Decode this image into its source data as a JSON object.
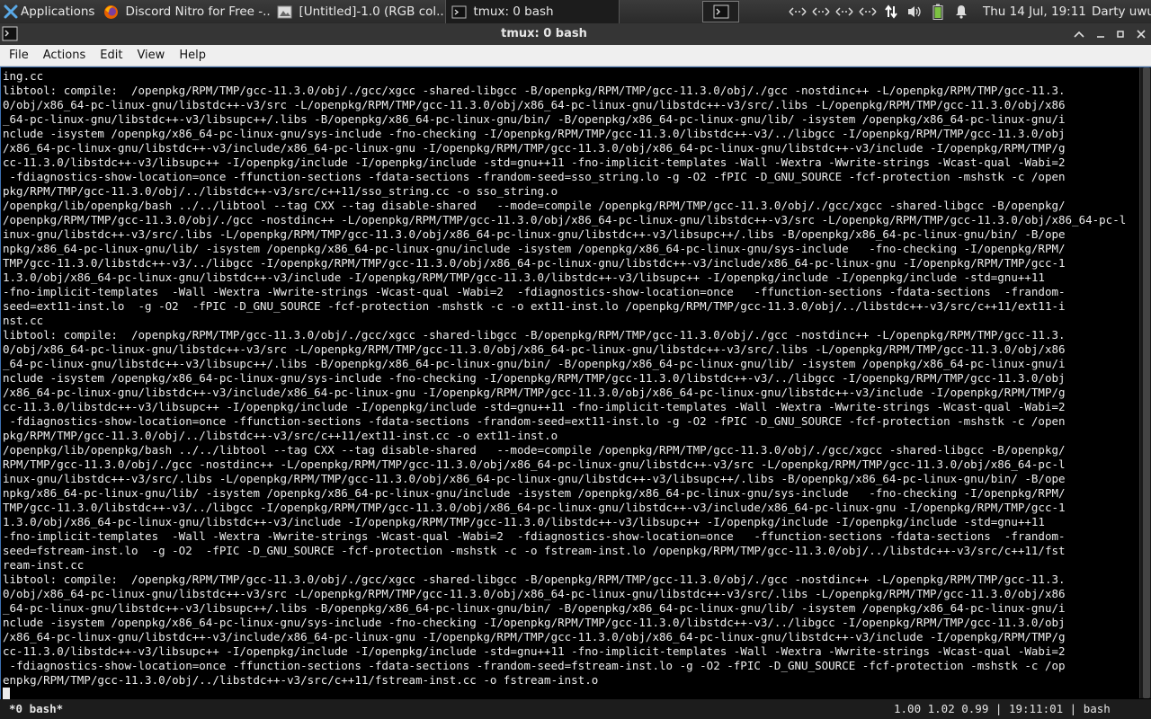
{
  "panel": {
    "app_menu_label": "Applications",
    "tasks": [
      {
        "label": "Discord Nitro for Free -..."
      },
      {
        "label": "[Untitled]-1.0 (RGB col..."
      },
      {
        "label": "tmux: 0 bash"
      }
    ],
    "clock": "Thu 14 Jul, 19:11",
    "user": "Darty uwu"
  },
  "window": {
    "title": "tmux: 0 bash"
  },
  "menubar": {
    "items": [
      "File",
      "Actions",
      "Edit",
      "View",
      "Help"
    ]
  },
  "terminal": {
    "lines": [
      "ing.cc",
      "libtool: compile:  /openpkg/RPM/TMP/gcc-11.3.0/obj/./gcc/xgcc -shared-libgcc -B/openpkg/RPM/TMP/gcc-11.3.0/obj/./gcc -nostdinc++ -L/openpkg/RPM/TMP/gcc-11.3.",
      "0/obj/x86_64-pc-linux-gnu/libstdc++-v3/src -L/openpkg/RPM/TMP/gcc-11.3.0/obj/x86_64-pc-linux-gnu/libstdc++-v3/src/.libs -L/openpkg/RPM/TMP/gcc-11.3.0/obj/x86",
      "_64-pc-linux-gnu/libstdc++-v3/libsupc++/.libs -B/openpkg/x86_64-pc-linux-gnu/bin/ -B/openpkg/x86_64-pc-linux-gnu/lib/ -isystem /openpkg/x86_64-pc-linux-gnu/i",
      "nclude -isystem /openpkg/x86_64-pc-linux-gnu/sys-include -fno-checking -I/openpkg/RPM/TMP/gcc-11.3.0/libstdc++-v3/../libgcc -I/openpkg/RPM/TMP/gcc-11.3.0/obj",
      "/x86_64-pc-linux-gnu/libstdc++-v3/include/x86_64-pc-linux-gnu -I/openpkg/RPM/TMP/gcc-11.3.0/obj/x86_64-pc-linux-gnu/libstdc++-v3/include -I/openpkg/RPM/TMP/g",
      "cc-11.3.0/libstdc++-v3/libsupc++ -I/openpkg/include -I/openpkg/include -std=gnu++11 -fno-implicit-templates -Wall -Wextra -Wwrite-strings -Wcast-qual -Wabi=2",
      " -fdiagnostics-show-location=once -ffunction-sections -fdata-sections -frandom-seed=sso_string.lo -g -O2 -fPIC -D_GNU_SOURCE -fcf-protection -mshstk -c /open",
      "pkg/RPM/TMP/gcc-11.3.0/obj/../libstdc++-v3/src/c++11/sso_string.cc -o sso_string.o",
      "/openpkg/lib/openpkg/bash ../../libtool --tag CXX --tag disable-shared   --mode=compile /openpkg/RPM/TMP/gcc-11.3.0/obj/./gcc/xgcc -shared-libgcc -B/openpkg/",
      "/openpkg/RPM/TMP/gcc-11.3.0/obj/./gcc -nostdinc++ -L/openpkg/RPM/TMP/gcc-11.3.0/obj/x86_64-pc-linux-gnu/libstdc++-v3/src -L/openpkg/RPM/TMP/gcc-11.3.0/obj/x86_64-pc-l",
      "inux-gnu/libstdc++-v3/src/.libs -L/openpkg/RPM/TMP/gcc-11.3.0/obj/x86_64-pc-linux-gnu/libstdc++-v3/libsupc++/.libs -B/openpkg/x86_64-pc-linux-gnu/bin/ -B/ope",
      "npkg/x86_64-pc-linux-gnu/lib/ -isystem /openpkg/x86_64-pc-linux-gnu/include -isystem /openpkg/x86_64-pc-linux-gnu/sys-include   -fno-checking -I/openpkg/RPM/",
      "TMP/gcc-11.3.0/libstdc++-v3/../libgcc -I/openpkg/RPM/TMP/gcc-11.3.0/obj/x86_64-pc-linux-gnu/libstdc++-v3/include/x86_64-pc-linux-gnu -I/openpkg/RPM/TMP/gcc-1",
      "1.3.0/obj/x86_64-pc-linux-gnu/libstdc++-v3/include -I/openpkg/RPM/TMP/gcc-11.3.0/libstdc++-v3/libsupc++ -I/openpkg/include -I/openpkg/include -std=gnu++11",
      "-fno-implicit-templates  -Wall -Wextra -Wwrite-strings -Wcast-qual -Wabi=2  -fdiagnostics-show-location=once   -ffunction-sections -fdata-sections  -frandom-",
      "seed=ext11-inst.lo  -g -O2  -fPIC -D_GNU_SOURCE -fcf-protection -mshstk -c -o ext11-inst.lo /openpkg/RPM/TMP/gcc-11.3.0/obj/../libstdc++-v3/src/c++11/ext11-i",
      "nst.cc",
      "libtool: compile:  /openpkg/RPM/TMP/gcc-11.3.0/obj/./gcc/xgcc -shared-libgcc -B/openpkg/RPM/TMP/gcc-11.3.0/obj/./gcc -nostdinc++ -L/openpkg/RPM/TMP/gcc-11.3.",
      "0/obj/x86_64-pc-linux-gnu/libstdc++-v3/src -L/openpkg/RPM/TMP/gcc-11.3.0/obj/x86_64-pc-linux-gnu/libstdc++-v3/src/.libs -L/openpkg/RPM/TMP/gcc-11.3.0/obj/x86",
      "_64-pc-linux-gnu/libstdc++-v3/libsupc++/.libs -B/openpkg/x86_64-pc-linux-gnu/bin/ -B/openpkg/x86_64-pc-linux-gnu/lib/ -isystem /openpkg/x86_64-pc-linux-gnu/i",
      "nclude -isystem /openpkg/x86_64-pc-linux-gnu/sys-include -fno-checking -I/openpkg/RPM/TMP/gcc-11.3.0/libstdc++-v3/../libgcc -I/openpkg/RPM/TMP/gcc-11.3.0/obj",
      "/x86_64-pc-linux-gnu/libstdc++-v3/include/x86_64-pc-linux-gnu -I/openpkg/RPM/TMP/gcc-11.3.0/obj/x86_64-pc-linux-gnu/libstdc++-v3/include -I/openpkg/RPM/TMP/g",
      "cc-11.3.0/libstdc++-v3/libsupc++ -I/openpkg/include -I/openpkg/include -std=gnu++11 -fno-implicit-templates -Wall -Wextra -Wwrite-strings -Wcast-qual -Wabi=2",
      " -fdiagnostics-show-location=once -ffunction-sections -fdata-sections -frandom-seed=ext11-inst.lo -g -O2 -fPIC -D_GNU_SOURCE -fcf-protection -mshstk -c /open",
      "pkg/RPM/TMP/gcc-11.3.0/obj/../libstdc++-v3/src/c++11/ext11-inst.cc -o ext11-inst.o",
      "/openpkg/lib/openpkg/bash ../../libtool --tag CXX --tag disable-shared   --mode=compile /openpkg/RPM/TMP/gcc-11.3.0/obj/./gcc/xgcc -shared-libgcc -B/openpkg/",
      "RPM/TMP/gcc-11.3.0/obj/./gcc -nostdinc++ -L/openpkg/RPM/TMP/gcc-11.3.0/obj/x86_64-pc-linux-gnu/libstdc++-v3/src -L/openpkg/RPM/TMP/gcc-11.3.0/obj/x86_64-pc-l",
      "inux-gnu/libstdc++-v3/src/.libs -L/openpkg/RPM/TMP/gcc-11.3.0/obj/x86_64-pc-linux-gnu/libstdc++-v3/libsupc++/.libs -B/openpkg/x86_64-pc-linux-gnu/bin/ -B/ope",
      "npkg/x86_64-pc-linux-gnu/lib/ -isystem /openpkg/x86_64-pc-linux-gnu/include -isystem /openpkg/x86_64-pc-linux-gnu/sys-include   -fno-checking -I/openpkg/RPM/",
      "TMP/gcc-11.3.0/libstdc++-v3/../libgcc -I/openpkg/RPM/TMP/gcc-11.3.0/obj/x86_64-pc-linux-gnu/libstdc++-v3/include/x86_64-pc-linux-gnu -I/openpkg/RPM/TMP/gcc-1",
      "1.3.0/obj/x86_64-pc-linux-gnu/libstdc++-v3/include -I/openpkg/RPM/TMP/gcc-11.3.0/libstdc++-v3/libsupc++ -I/openpkg/include -I/openpkg/include -std=gnu++11",
      "-fno-implicit-templates  -Wall -Wextra -Wwrite-strings -Wcast-qual -Wabi=2  -fdiagnostics-show-location=once   -ffunction-sections -fdata-sections  -frandom-",
      "seed=fstream-inst.lo  -g -O2  -fPIC -D_GNU_SOURCE -fcf-protection -mshstk -c -o fstream-inst.lo /openpkg/RPM/TMP/gcc-11.3.0/obj/../libstdc++-v3/src/c++11/fst",
      "ream-inst.cc",
      "libtool: compile:  /openpkg/RPM/TMP/gcc-11.3.0/obj/./gcc/xgcc -shared-libgcc -B/openpkg/RPM/TMP/gcc-11.3.0/obj/./gcc -nostdinc++ -L/openpkg/RPM/TMP/gcc-11.3.",
      "0/obj/x86_64-pc-linux-gnu/libstdc++-v3/src -L/openpkg/RPM/TMP/gcc-11.3.0/obj/x86_64-pc-linux-gnu/libstdc++-v3/src/.libs -L/openpkg/RPM/TMP/gcc-11.3.0/obj/x86",
      "_64-pc-linux-gnu/libstdc++-v3/libsupc++/.libs -B/openpkg/x86_64-pc-linux-gnu/bin/ -B/openpkg/x86_64-pc-linux-gnu/lib/ -isystem /openpkg/x86_64-pc-linux-gnu/i",
      "nclude -isystem /openpkg/x86_64-pc-linux-gnu/sys-include -fno-checking -I/openpkg/RPM/TMP/gcc-11.3.0/libstdc++-v3/../libgcc -I/openpkg/RPM/TMP/gcc-11.3.0/obj",
      "/x86_64-pc-linux-gnu/libstdc++-v3/include/x86_64-pc-linux-gnu -I/openpkg/RPM/TMP/gcc-11.3.0/obj/x86_64-pc-linux-gnu/libstdc++-v3/include -I/openpkg/RPM/TMP/g",
      "cc-11.3.0/libstdc++-v3/libsupc++ -I/openpkg/include -I/openpkg/include -std=gnu++11 -fno-implicit-templates -Wall -Wextra -Wwrite-strings -Wcast-qual -Wabi=2",
      " -fdiagnostics-show-location=once -ffunction-sections -fdata-sections -frandom-seed=fstream-inst.lo -g -O2 -fPIC -D_GNU_SOURCE -fcf-protection -mshstk -c /op",
      "enpkg/RPM/TMP/gcc-11.3.0/obj/../libstdc++-v3/src/c++11/fstream-inst.cc -o fstream-inst.o"
    ]
  },
  "tmux": {
    "window_label": "*0 bash*",
    "load": "1.00 1.02 0.99",
    "time": "19:11:01",
    "session": "bash"
  },
  "colors": {
    "accent": "#3c6fb0",
    "panel_bg": "#2f2f2f",
    "terminal_bg": "#000000",
    "terminal_fg": "#ededed"
  }
}
